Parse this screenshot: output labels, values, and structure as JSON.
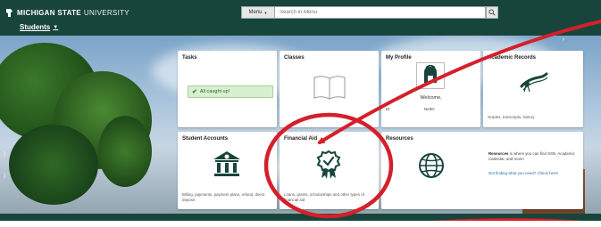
{
  "header": {
    "brand_bold": "MICHIGAN STATE",
    "brand_light": "UNIVERSITY",
    "nav_students": "Students"
  },
  "search": {
    "scope": "Menu",
    "placeholder": "Search in Menu"
  },
  "tiles": {
    "tasks": {
      "title": "Tasks",
      "badge": "All caught up!"
    },
    "classes": {
      "title": "Classes"
    },
    "profile": {
      "title": "My Profile",
      "welcome": "Welcome,",
      "id_label": "ID",
      "netid_label": "NetID"
    },
    "records": {
      "title": "Academic Records",
      "footer": "Grades, transcripts, history"
    },
    "accounts": {
      "title": "Student Accounts",
      "footer": "Billing, payments, payment plans, refund, direct deposit"
    },
    "finaid": {
      "title": "Financial Aid",
      "footer": "Loans, grants, scholarships and other types of financial aid"
    },
    "resources": {
      "title": "Resources",
      "desc_bold": "Resources",
      "desc_rest": " is where you can find SSN, Academic Calendar, and more!",
      "link": "Not finding what you need? Check here!"
    }
  },
  "colors": {
    "msu_green": "#18453b",
    "annotation_red": "#d4202a",
    "icon_green": "#18453b"
  },
  "icons": [
    "spartan-logo",
    "search-icon",
    "book-icon",
    "spartan-helmet-icon",
    "diploma-icon",
    "bank-icon",
    "award-badge-icon",
    "globe-icon"
  ]
}
